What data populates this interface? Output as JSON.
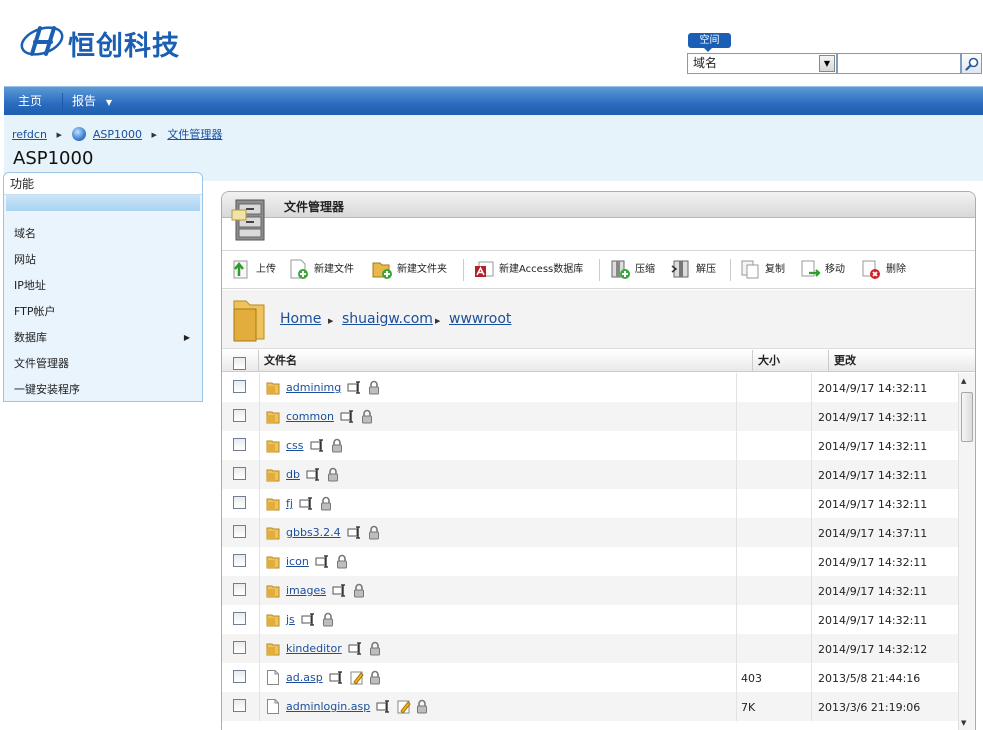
{
  "header": {
    "logo_text": "恒创科技",
    "space_label": "空间",
    "search_select_value": "域名"
  },
  "nav": {
    "home": "主页",
    "reports": "报告"
  },
  "breadcrumb": {
    "root": "refdcn",
    "site": "ASP1000",
    "current": "文件管理器"
  },
  "page_title": "ASP1000",
  "sidebar": {
    "heading": "功能",
    "items": [
      {
        "label": "域名"
      },
      {
        "label": "网站"
      },
      {
        "label": "IP地址"
      },
      {
        "label": "FTP帐户"
      },
      {
        "label": "数据库"
      },
      {
        "label": "文件管理器"
      },
      {
        "label": "一键安装程序"
      }
    ]
  },
  "file_manager": {
    "title": "文件管理器",
    "toolbar": {
      "upload": "上传",
      "new_file": "新建文件",
      "new_folder": "新建文件夹",
      "new_access_db": "新建Access数据库",
      "compress": "压缩",
      "extract": "解压",
      "copy": "复制",
      "move": "移动",
      "delete": "删除"
    },
    "path": [
      "Home",
      "shuaigw.com",
      "wwwroot"
    ],
    "columns": {
      "name": "文件名",
      "size": "大小",
      "modified": "更改"
    },
    "rows": [
      {
        "name": "adminimg",
        "type": "folder",
        "size": "",
        "date": "2014/9/17 14:32:11"
      },
      {
        "name": "common",
        "type": "folder",
        "size": "",
        "date": "2014/9/17 14:32:11"
      },
      {
        "name": "css",
        "type": "folder",
        "size": "",
        "date": "2014/9/17 14:32:11"
      },
      {
        "name": "db",
        "type": "folder",
        "size": "",
        "date": "2014/9/17 14:32:11"
      },
      {
        "name": "fj",
        "type": "folder",
        "size": "",
        "date": "2014/9/17 14:32:11"
      },
      {
        "name": "gbbs3.2.4",
        "type": "folder",
        "size": "",
        "date": "2014/9/17 14:37:11"
      },
      {
        "name": "icon",
        "type": "folder",
        "size": "",
        "date": "2014/9/17 14:32:11"
      },
      {
        "name": "images",
        "type": "folder",
        "size": "",
        "date": "2014/9/17 14:32:11"
      },
      {
        "name": "js",
        "type": "folder",
        "size": "",
        "date": "2014/9/17 14:32:11"
      },
      {
        "name": "kindeditor",
        "type": "folder",
        "size": "",
        "date": "2014/9/17 14:32:12"
      },
      {
        "name": "ad.asp",
        "type": "file",
        "size": "403",
        "date": "2013/5/8 21:44:16"
      },
      {
        "name": "adminlogin.asp",
        "type": "file",
        "size": "7K",
        "date": "2013/3/6 21:19:06"
      }
    ]
  },
  "colors": {
    "brand_blue": "#1a5fb4",
    "nav_blue": "#2a6bbf",
    "link": "#1a4f9c",
    "light_bg": "#e7f3fb"
  }
}
